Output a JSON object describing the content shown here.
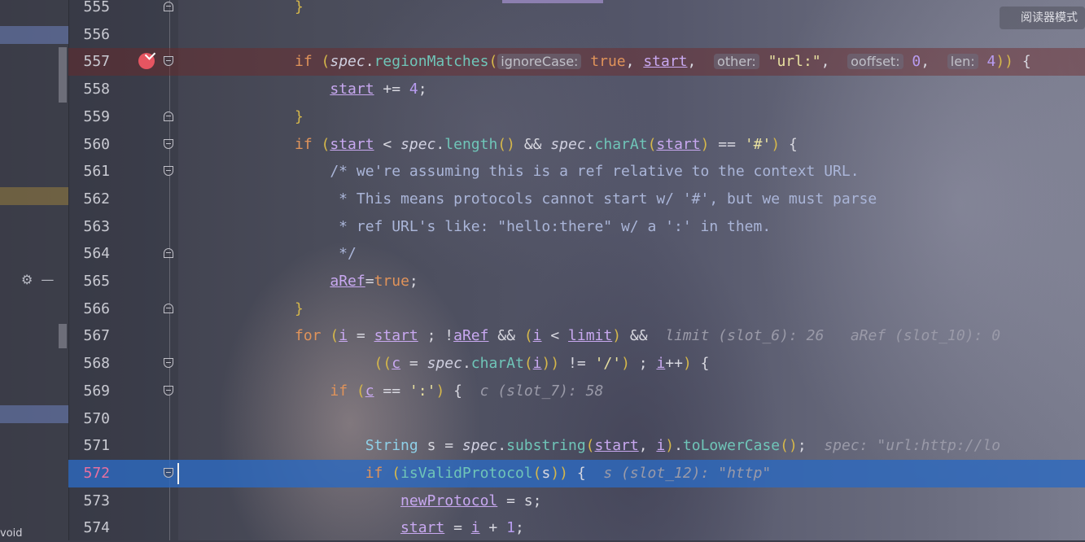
{
  "reader_mode_label": "阅读器模式",
  "left_panel": {
    "bottom_text": "void",
    "settings_icon": "gear-icon",
    "minimize_icon": "minus-icon"
  },
  "lines": [
    {
      "n": "555",
      "tokens": [
        {
          "c": "par",
          "t": "}"
        }
      ]
    },
    {
      "n": "556",
      "tokens": []
    },
    {
      "n": "557",
      "tokens": [
        {
          "c": "kw",
          "t": "if "
        },
        {
          "c": "par",
          "t": "("
        },
        {
          "c": "it",
          "t": "spec"
        },
        {
          "c": "",
          "t": "."
        },
        {
          "c": "fn",
          "t": "regionMatches"
        },
        {
          "c": "par",
          "t": "("
        },
        {
          "c": "hint",
          "t": "ignoreCase:"
        },
        {
          "c": "kw",
          "t": " true"
        },
        {
          "c": "",
          "t": ", "
        },
        {
          "c": "var",
          "t": "start"
        },
        {
          "c": "",
          "t": ",  "
        },
        {
          "c": "hint",
          "t": "other:"
        },
        {
          "c": "str",
          "t": " \"url:\""
        },
        {
          "c": "",
          "t": ",  "
        },
        {
          "c": "hint",
          "t": "ooffset:"
        },
        {
          "c": "num",
          "t": " 0"
        },
        {
          "c": "",
          "t": ",  "
        },
        {
          "c": "hint",
          "t": "len:"
        },
        {
          "c": "num",
          "t": " 4"
        },
        {
          "c": "par",
          "t": "))"
        },
        {
          "c": "",
          "t": " {"
        }
      ]
    },
    {
      "n": "558",
      "tokens": [
        {
          "c": "",
          "t": "    "
        },
        {
          "c": "var",
          "t": "start"
        },
        {
          "c": "",
          "t": " += "
        },
        {
          "c": "num",
          "t": "4"
        },
        {
          "c": "",
          "t": ";"
        }
      ]
    },
    {
      "n": "559",
      "tokens": [
        {
          "c": "par",
          "t": "}"
        }
      ]
    },
    {
      "n": "560",
      "tokens": [
        {
          "c": "kw",
          "t": "if "
        },
        {
          "c": "par",
          "t": "("
        },
        {
          "c": "var",
          "t": "start"
        },
        {
          "c": "",
          "t": " < "
        },
        {
          "c": "it",
          "t": "spec"
        },
        {
          "c": "",
          "t": "."
        },
        {
          "c": "fn",
          "t": "length"
        },
        {
          "c": "par",
          "t": "()"
        },
        {
          "c": "",
          "t": " && "
        },
        {
          "c": "it",
          "t": "spec"
        },
        {
          "c": "",
          "t": "."
        },
        {
          "c": "fn",
          "t": "charAt"
        },
        {
          "c": "par",
          "t": "("
        },
        {
          "c": "var",
          "t": "start"
        },
        {
          "c": "par",
          "t": ")"
        },
        {
          "c": "",
          "t": " == "
        },
        {
          "c": "str",
          "t": "'#'"
        },
        {
          "c": "par",
          "t": ")"
        },
        {
          "c": "",
          "t": " {"
        }
      ]
    },
    {
      "n": "561",
      "tokens": [
        {
          "c": "cm",
          "t": "    /* we're assuming this is a ref relative to the context URL."
        }
      ]
    },
    {
      "n": "562",
      "tokens": [
        {
          "c": "cm",
          "t": "     * This means protocols cannot start w/ '#', but we must parse"
        }
      ]
    },
    {
      "n": "563",
      "tokens": [
        {
          "c": "cm",
          "t": "     * ref URL's like: \"hello:there\" w/ a ':' in them."
        }
      ]
    },
    {
      "n": "564",
      "tokens": [
        {
          "c": "cm",
          "t": "     */"
        }
      ]
    },
    {
      "n": "565",
      "tokens": [
        {
          "c": "",
          "t": "    "
        },
        {
          "c": "var",
          "t": "aRef"
        },
        {
          "c": "",
          "t": "="
        },
        {
          "c": "kw",
          "t": "true"
        },
        {
          "c": "",
          "t": ";"
        }
      ]
    },
    {
      "n": "566",
      "tokens": [
        {
          "c": "par",
          "t": "}"
        }
      ]
    },
    {
      "n": "567",
      "tokens": [
        {
          "c": "kw",
          "t": "for "
        },
        {
          "c": "par",
          "t": "("
        },
        {
          "c": "var",
          "t": "i"
        },
        {
          "c": "",
          "t": " = "
        },
        {
          "c": "var",
          "t": "start"
        },
        {
          "c": "",
          "t": " ; !"
        },
        {
          "c": "var",
          "t": "aRef"
        },
        {
          "c": "",
          "t": " && "
        },
        {
          "c": "par",
          "t": "("
        },
        {
          "c": "var",
          "t": "i"
        },
        {
          "c": "",
          "t": " < "
        },
        {
          "c": "var",
          "t": "limit"
        },
        {
          "c": "par",
          "t": ")"
        },
        {
          "c": "",
          "t": " &&  "
        },
        {
          "c": "dbg",
          "t": "limit (slot_6): 26   aRef (slot_10): 0"
        }
      ]
    },
    {
      "n": "568",
      "tokens": [
        {
          "c": "",
          "t": "         "
        },
        {
          "c": "par",
          "t": "(("
        },
        {
          "c": "var",
          "t": "c"
        },
        {
          "c": "",
          "t": " = "
        },
        {
          "c": "it",
          "t": "spec"
        },
        {
          "c": "",
          "t": "."
        },
        {
          "c": "fn",
          "t": "charAt"
        },
        {
          "c": "par",
          "t": "("
        },
        {
          "c": "var",
          "t": "i"
        },
        {
          "c": "par",
          "t": "))"
        },
        {
          "c": "",
          "t": " != "
        },
        {
          "c": "str",
          "t": "'/'"
        },
        {
          "c": "par",
          "t": ")"
        },
        {
          "c": "",
          "t": " ; "
        },
        {
          "c": "var",
          "t": "i"
        },
        {
          "c": "",
          "t": "++"
        },
        {
          "c": "par",
          "t": ")"
        },
        {
          "c": "",
          "t": " {"
        }
      ]
    },
    {
      "n": "569",
      "tokens": [
        {
          "c": "",
          "t": "    "
        },
        {
          "c": "kw",
          "t": "if "
        },
        {
          "c": "par",
          "t": "("
        },
        {
          "c": "var",
          "t": "c"
        },
        {
          "c": "",
          "t": " == "
        },
        {
          "c": "str",
          "t": "':'"
        },
        {
          "c": "par",
          "t": ")"
        },
        {
          "c": "",
          "t": " {  "
        },
        {
          "c": "dbg",
          "t": "c (slot_7): 58"
        }
      ]
    },
    {
      "n": "570",
      "tokens": []
    },
    {
      "n": "571",
      "tokens": [
        {
          "c": "",
          "t": "        "
        },
        {
          "c": "type",
          "t": "String"
        },
        {
          "c": "",
          "t": " s = "
        },
        {
          "c": "it",
          "t": "spec"
        },
        {
          "c": "",
          "t": "."
        },
        {
          "c": "fn",
          "t": "substring"
        },
        {
          "c": "par",
          "t": "("
        },
        {
          "c": "var",
          "t": "start"
        },
        {
          "c": "",
          "t": ", "
        },
        {
          "c": "var",
          "t": "i"
        },
        {
          "c": "par",
          "t": ")"
        },
        {
          "c": "",
          "t": "."
        },
        {
          "c": "fn",
          "t": "toLowerCase"
        },
        {
          "c": "par",
          "t": "()"
        },
        {
          "c": "",
          "t": ";  "
        },
        {
          "c": "dbg",
          "t": "spec: \"url:http://lo"
        }
      ]
    },
    {
      "n": "572",
      "tokens": [
        {
          "c": "",
          "t": "        "
        },
        {
          "c": "kw",
          "t": "if "
        },
        {
          "c": "par",
          "t": "("
        },
        {
          "c": "fn",
          "t": "isValidProtocol"
        },
        {
          "c": "par",
          "t": "("
        },
        {
          "c": "",
          "t": "s"
        },
        {
          "c": "par",
          "t": "))"
        },
        {
          "c": "",
          "t": " {  "
        },
        {
          "c": "dbg",
          "t": "s (slot_12): \"http\""
        }
      ]
    },
    {
      "n": "573",
      "tokens": [
        {
          "c": "",
          "t": "            "
        },
        {
          "c": "var",
          "t": "newProtocol"
        },
        {
          "c": "",
          "t": " = s;"
        }
      ]
    },
    {
      "n": "574",
      "tokens": [
        {
          "c": "",
          "t": "            "
        },
        {
          "c": "var",
          "t": "start"
        },
        {
          "c": "",
          "t": " = "
        },
        {
          "c": "var",
          "t": "i"
        },
        {
          "c": "",
          "t": " + "
        },
        {
          "c": "num",
          "t": "1"
        },
        {
          "c": "",
          "t": ";"
        }
      ]
    }
  ],
  "breakpoint_line": "557",
  "current_line": "572"
}
